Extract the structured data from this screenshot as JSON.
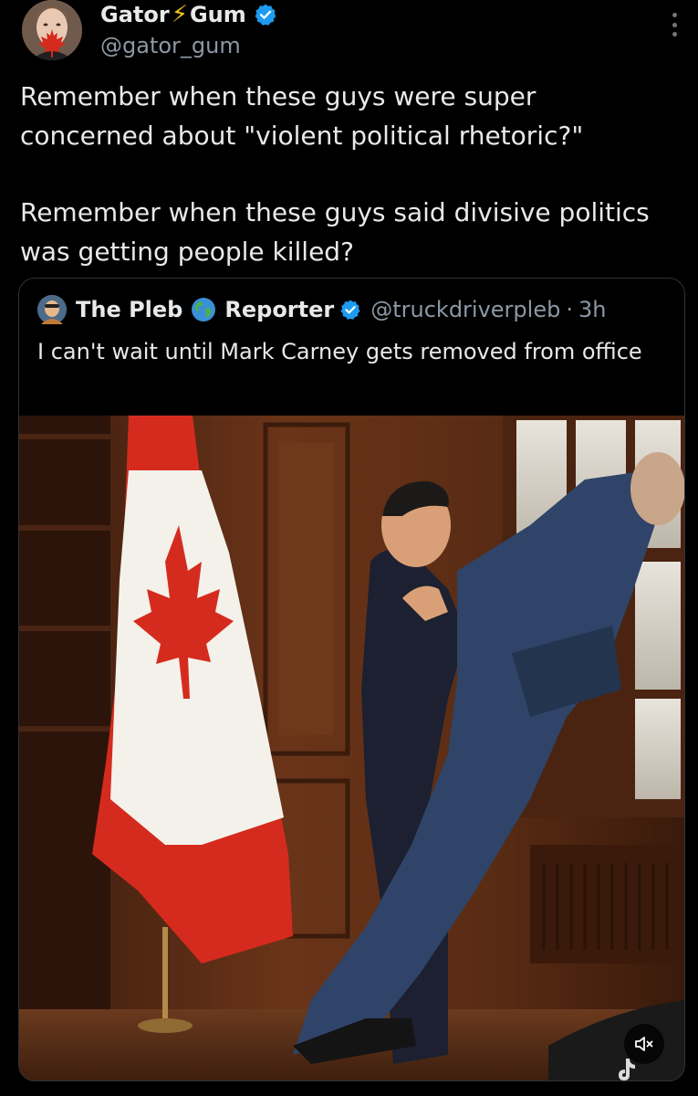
{
  "author": {
    "name_part1": "Gator",
    "name_part2": "Gum",
    "handle": "@gator_gum",
    "verified": true,
    "avatar_icon": "avatar-woman-maple-leaf"
  },
  "tweet": {
    "paragraph1": "Remember when these guys were super concerned about \"violent political rhetoric?\"",
    "paragraph2": "Remember when these guys said divisive politics was getting people killed?"
  },
  "quoted": {
    "name_part1": "The Pleb",
    "name_part2": "Reporter",
    "handle": "@truckdriverpleb",
    "separator": "·",
    "time": "3h",
    "text": "I can't wait until Mark Carney gets removed from office",
    "verified": true
  },
  "media": {
    "description_icon": "video-thumbnail",
    "mute_icon": "volume-muted-icon",
    "watermark_icon": "tiktok-logo-icon"
  },
  "colors": {
    "background": "#000000",
    "text": "#e7e9ea",
    "secondary_text": "#8b98a5",
    "verified_blue": "#1d9bf0",
    "border": "#2f3336",
    "canada_red": "#d52b1e"
  }
}
